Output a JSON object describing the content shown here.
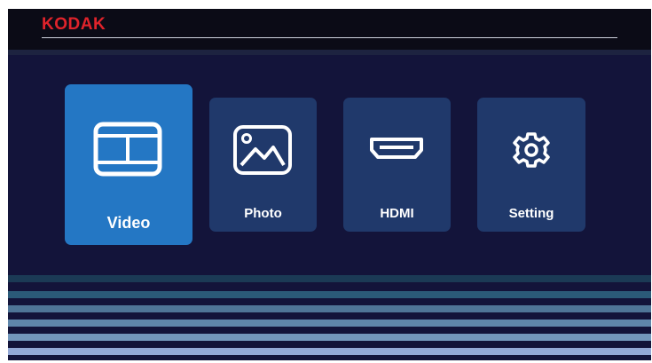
{
  "header": {
    "brand": "KODAK"
  },
  "menu": {
    "items": [
      {
        "label": "Video",
        "icon": "film-icon",
        "selected": true
      },
      {
        "label": "Photo",
        "icon": "image-icon",
        "selected": false
      },
      {
        "label": "HDMI",
        "icon": "hdmi-port-icon",
        "selected": false
      },
      {
        "label": "Setting",
        "icon": "gear-icon",
        "selected": false
      }
    ]
  },
  "colors": {
    "brand": "#e0232b",
    "background": "#13143a",
    "tile": "#20396b",
    "tile_selected": "#2477c4"
  }
}
